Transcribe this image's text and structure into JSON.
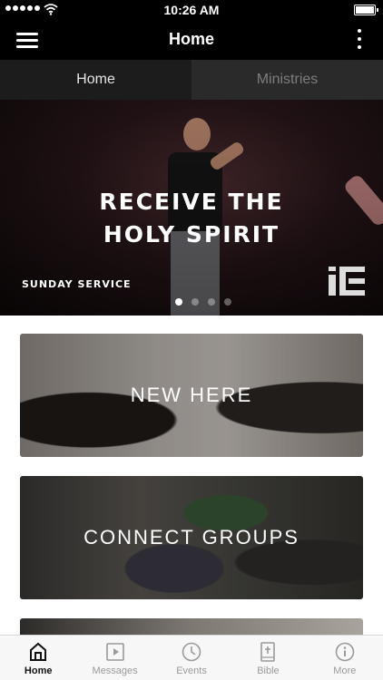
{
  "status_bar": {
    "time": "10:26 AM",
    "signal_icon": "signal-dots-icon",
    "wifi_icon": "wifi-icon",
    "battery_icon": "battery-icon"
  },
  "nav": {
    "title": "Home",
    "menu_icon": "hamburger-menu-icon",
    "more_icon": "vertical-ellipsis-icon"
  },
  "tabs": [
    {
      "label": "Home",
      "active": true
    },
    {
      "label": "Ministries",
      "active": false
    }
  ],
  "hero": {
    "headline_line1": "RECEIVE THE",
    "headline_line2": "HOLY SPIRIT",
    "subtitle": "SUNDAY SERVICE",
    "logo_icon": "ic-logo-icon",
    "carousel_pages": 4,
    "carousel_active_index": 0
  },
  "cards": [
    {
      "label": "NEW HERE"
    },
    {
      "label": "CONNECT GROUPS"
    },
    {
      "label": ""
    }
  ],
  "tab_bar": {
    "items": [
      {
        "label": "Home",
        "icon": "home-icon",
        "active": true
      },
      {
        "label": "Messages",
        "icon": "play-video-icon",
        "active": false
      },
      {
        "label": "Events",
        "icon": "clock-icon",
        "active": false
      },
      {
        "label": "Bible",
        "icon": "bible-icon",
        "active": false
      },
      {
        "label": "More",
        "icon": "info-icon",
        "active": false
      }
    ],
    "active_color": "#111111",
    "inactive_color": "#9a9a9a"
  }
}
